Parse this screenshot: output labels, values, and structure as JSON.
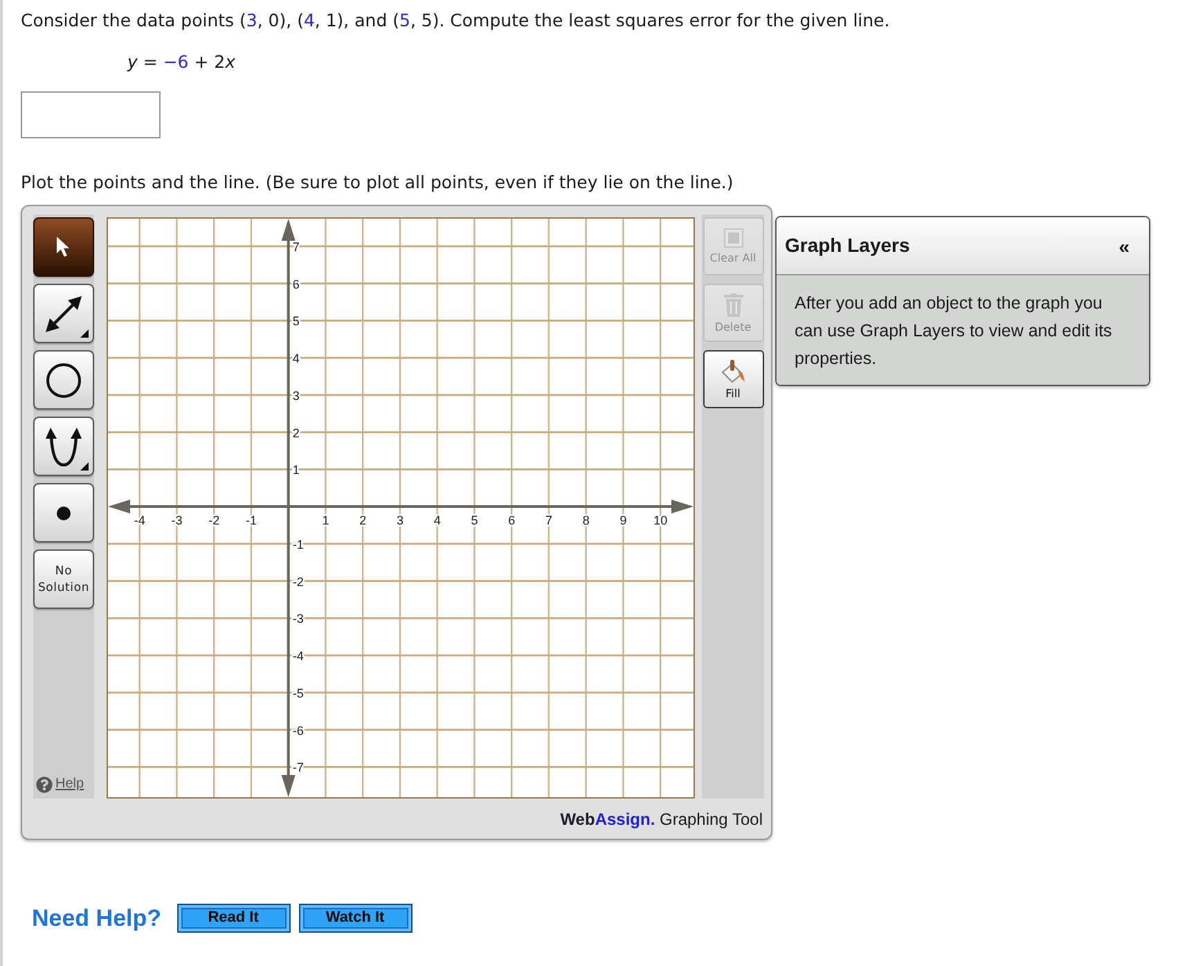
{
  "question": [
    {
      "text": "Consider the data points (",
      "kind": "plain"
    },
    {
      "text": "3",
      "kind": "value"
    },
    {
      "text": ", 0), (",
      "kind": "plain"
    },
    {
      "text": "4",
      "kind": "value"
    },
    {
      "text": ", 1), and (",
      "kind": "plain"
    },
    {
      "text": "5",
      "kind": "value"
    },
    {
      "text": ", 5). Compute the least squares error for the given line.",
      "kind": "plain"
    }
  ],
  "equation": [
    {
      "text": "y",
      "kind": "variable"
    },
    {
      "text": " = ",
      "kind": "plain"
    },
    {
      "text": "−6",
      "kind": "value"
    },
    {
      "text": " + 2",
      "kind": "plain"
    },
    {
      "text": "x",
      "kind": "variable"
    }
  ],
  "instruction": "Plot the points and the line. (Be sure to plot all points, even if they lie on the line.)",
  "graph_tool": {
    "tools": [
      {
        "kind": "pointer",
        "selected": true,
        "submenu": false
      },
      {
        "kind": "line",
        "selected": false,
        "submenu": true
      },
      {
        "kind": "circle",
        "selected": false,
        "submenu": false
      },
      {
        "kind": "parabola",
        "selected": false,
        "submenu": true
      },
      {
        "kind": "point",
        "selected": false,
        "submenu": false
      },
      {
        "kind": "no_solution",
        "label": "No Solution",
        "selected": false,
        "submenu": false
      }
    ],
    "help_link": "Help",
    "chart_data": {
      "type": "scatter",
      "grid": true,
      "xlim": [
        -4.85,
        10.89
      ],
      "ylim": [
        -7.81,
        7.74
      ],
      "xticks": [
        -4,
        -3,
        -2,
        -1,
        1,
        2,
        3,
        4,
        5,
        6,
        7,
        8,
        9,
        10
      ],
      "yticks": [
        -7,
        -6,
        -5,
        -4,
        -3,
        -2,
        -1,
        1,
        2,
        3,
        4,
        5,
        6,
        7
      ]
    },
    "side_buttons": [
      {
        "kind": "clear",
        "label": "Clear All",
        "disabled": true
      },
      {
        "kind": "delete",
        "label": "Delete",
        "disabled": true
      },
      {
        "kind": "fill",
        "label": "Fill",
        "disabled": false
      }
    ],
    "branding": [
      {
        "text": "Web",
        "kind": "brand"
      },
      {
        "text": "Assign.",
        "kind": "brand_accent"
      },
      {
        "text": " Graphing Tool",
        "kind": "plain"
      }
    ],
    "layers_panel": {
      "title": "Graph Layers",
      "collapse": "«",
      "message": "After you add an object to the graph you can use Graph Layers to view and edit its properties."
    }
  },
  "help": {
    "label": "Need Help?",
    "buttons": [
      "Read It",
      "Watch It"
    ]
  }
}
